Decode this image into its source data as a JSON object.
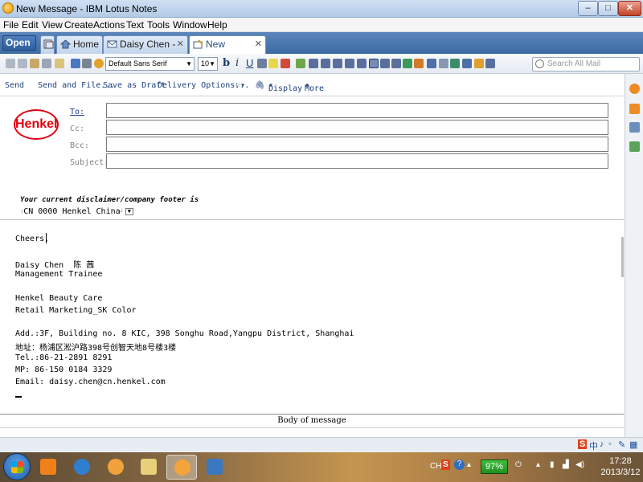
{
  "window": {
    "title": "New Message - IBM Lotus Notes",
    "buttons": [
      "–",
      "□",
      "✕"
    ]
  },
  "menu": [
    "File",
    "Edit",
    "View",
    "Create",
    "Actions",
    "Text",
    "Tools",
    "Window",
    "Help"
  ],
  "tabs": {
    "open_label": "Open",
    "items": [
      {
        "label": "Home"
      },
      {
        "label": "Daisy Chen - Mail"
      },
      {
        "label": "New Message"
      }
    ]
  },
  "toolbar": {
    "font_name": "Default Sans Serif",
    "font_size": "10",
    "bold": "b",
    "italic": "i",
    "underline": "U",
    "search_placeholder": "Search All Mail"
  },
  "actions": {
    "send": "Send",
    "send_and_file": "Send and File...",
    "save_draft": "Save as Draft",
    "delivery_options": "Delivery Options...",
    "display": "Display",
    "more": "More"
  },
  "header": {
    "logo_text": "Henkel",
    "to_label": "To:",
    "cc_label": "Cc:",
    "bcc_label": "Bcc:",
    "subject_label": "Subject:",
    "to_value": "",
    "cc_value": "",
    "bcc_value": "",
    "subject_value": "",
    "disclaimer_text": "Your current disclaimer/company footer is",
    "footer_value": "CN 0000 Henkel China"
  },
  "body": {
    "lines": [
      "Cheers,",
      "Daisy Chen  陈 茜",
      "Management Trainee",
      "Henkel Beauty Care",
      "Retail Marketing_SK Color",
      "Add.:3F, Building no. 8 KIC, 398 Songhu Road,Yangpu District, Shanghai",
      "地址：杨浦区淞沪路398号创智天地8号楼3楼",
      "Tel.:86-21-2891 8291",
      "MP: 86-150 0184 3329",
      "Email: daisy.chen@cn.henkel.com"
    ],
    "section_label": "Body of message"
  },
  "status": {
    "ime_chars": [
      "S",
      "中",
      "♪",
      "◦",
      "✎",
      "▦"
    ]
  },
  "taskbar": {
    "lang": "CH",
    "battery": "97%",
    "time": "17:28",
    "date": "2013/3/12"
  },
  "colors": {
    "brand_red": "#e1000f",
    "tab_blue": "#3d6aa3",
    "link_blue": "#1c3f7a"
  }
}
